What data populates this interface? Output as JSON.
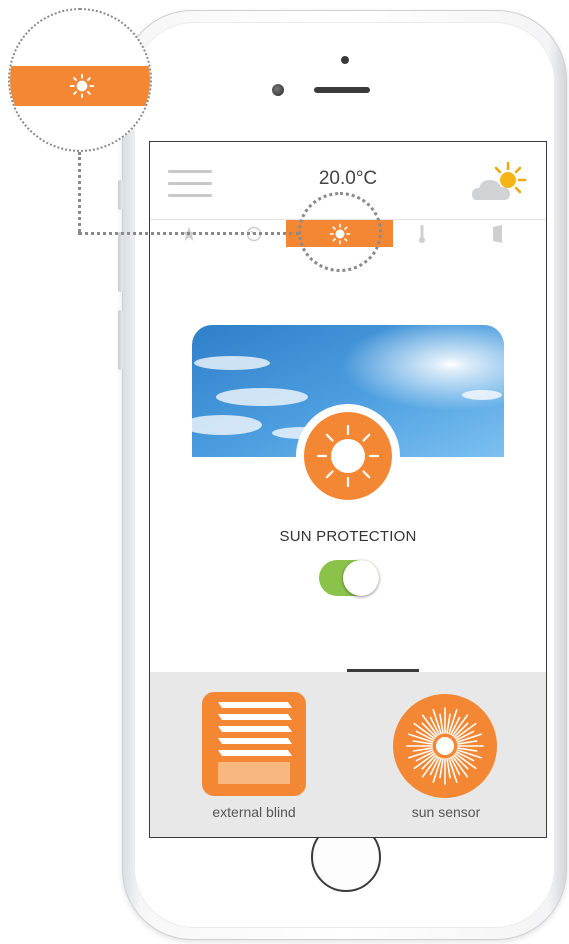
{
  "status": {
    "temperature": "20.0°C"
  },
  "header": {
    "menu_icon": "hamburger-menu-icon",
    "weather_icon": "partly-sunny-icon"
  },
  "tabs": [
    {
      "icon": "star-icon",
      "active": false
    },
    {
      "icon": "clock-icon",
      "active": false
    },
    {
      "icon": "sun-icon",
      "active": true
    },
    {
      "icon": "thermometer-icon",
      "active": false
    },
    {
      "icon": "door-icon",
      "active": false
    }
  ],
  "main": {
    "title": "SUN PROTECTION",
    "toggle_on": true
  },
  "devices": [
    {
      "label": "external blind",
      "icon": "blind-icon"
    },
    {
      "label": "sun sensor",
      "icon": "sun-sensor-icon"
    }
  ],
  "colors": {
    "accent": "#f48734",
    "toggle_on": "#8bc34a",
    "panel_bg": "#e8e8e8"
  }
}
